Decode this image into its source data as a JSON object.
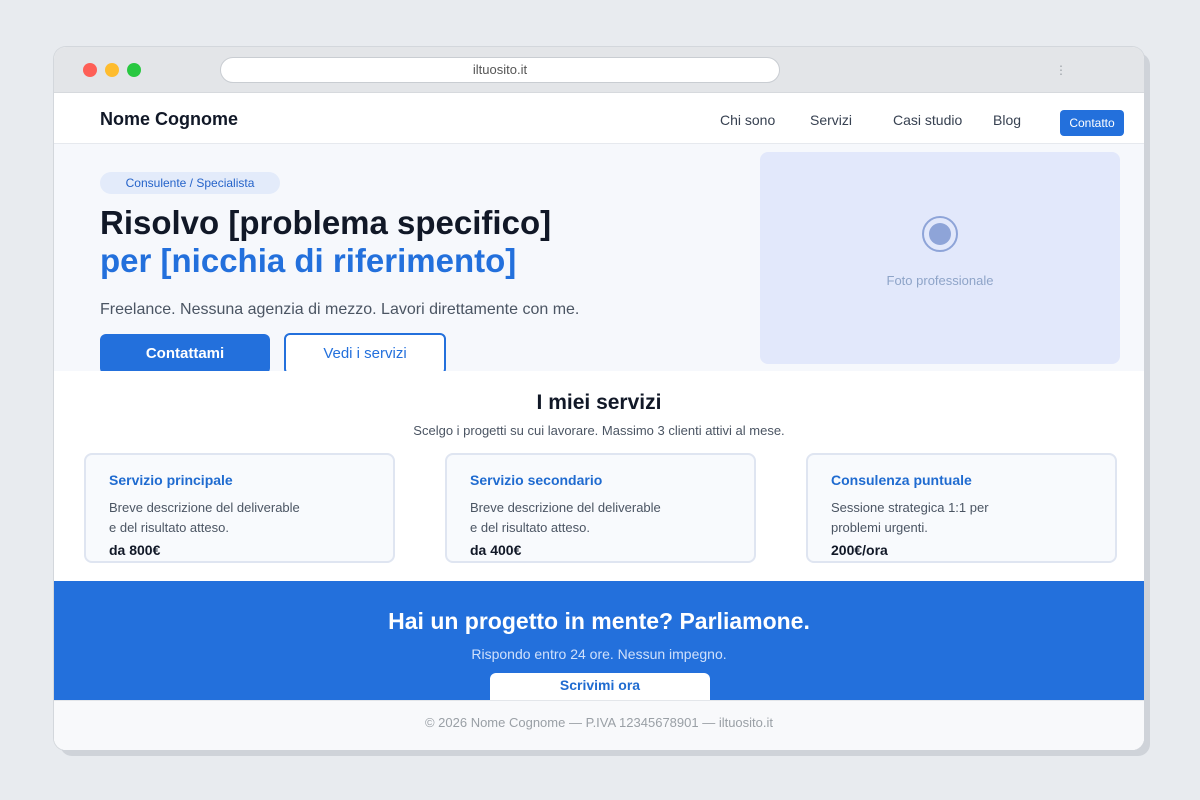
{
  "browser": {
    "url": "iltuosito.it",
    "menu_icon": "⋮"
  },
  "nav": {
    "brand": "Nome Cognome",
    "links": [
      "Chi sono",
      "Servizi",
      "Casi studio",
      "Blog"
    ],
    "cta": "Contatto"
  },
  "hero": {
    "badge": "Consulente / Specialista",
    "title_line1": "Risolvo [problema specifico]",
    "title_line2": "per [nicchia di riferimento]",
    "subtitle": "Freelance. Nessuna agenzia di mezzo. Lavori direttamente con me.",
    "primary_button": "Contattami",
    "secondary_button": "Vedi i servizi",
    "photo_label": "Foto professionale"
  },
  "services": {
    "title": "I miei servizi",
    "subtitle": "Scelgo i progetti su cui lavorare. Massimo 3 clienti attivi al mese.",
    "cards": [
      {
        "title": "Servizio principale",
        "desc_line1": "Breve descrizione del deliverable",
        "desc_line2": "e del risultato atteso.",
        "price": "da 800€"
      },
      {
        "title": "Servizio secondario",
        "desc_line1": "Breve descrizione del deliverable",
        "desc_line2": "e del risultato atteso.",
        "price": "da 400€"
      },
      {
        "title": "Consulenza puntuale",
        "desc_line1": "Sessione strategica 1:1 per",
        "desc_line2": "problemi urgenti.",
        "price": "200€/ora"
      }
    ]
  },
  "cta": {
    "title": "Hai un progetto in mente? Parliamone.",
    "subtitle": "Rispondo entro 24 ore. Nessun impegno.",
    "button": "Scrivimi ora"
  },
  "footer": {
    "text": "© 2026 Nome Cognome — P.IVA 12345678901 — iltuosito.it"
  },
  "colors": {
    "accent": "#2370dc",
    "hero_bg": "#f6f8fc",
    "photo_bg": "#e2e8fb"
  }
}
